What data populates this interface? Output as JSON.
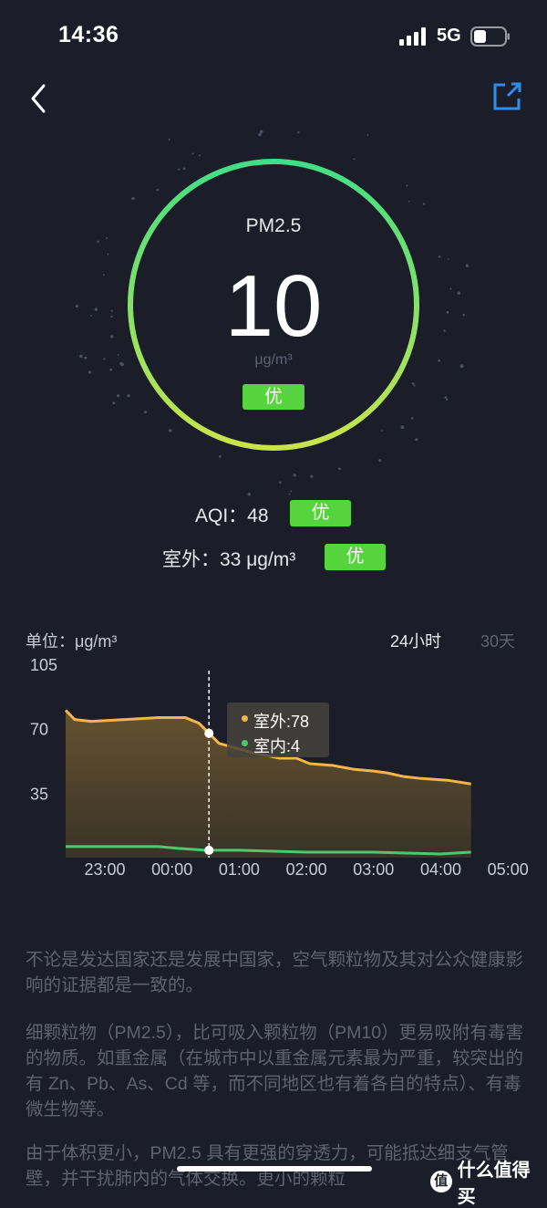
{
  "status_bar": {
    "time": "14:36",
    "network": "5G",
    "icons": [
      "signal-bars-icon",
      "battery-icon"
    ]
  },
  "nav": {
    "icons": [
      "back-chevron-icon",
      "share-icon"
    ],
    "accent": "#2f8cf0"
  },
  "gauge": {
    "pollutant": "PM2.5",
    "value": "10",
    "unit": "μg/m³",
    "level": "优",
    "ring_colors": [
      "#42e08a",
      "#c9e24a"
    ]
  },
  "aqi": {
    "label": "AQI：48",
    "level": "优"
  },
  "outdoor": {
    "label": "室外：33 μg/m³",
    "level": "优"
  },
  "chart_header": {
    "unit_label": "单位：μg/m³",
    "tabs": [
      "24小时",
      "30天"
    ],
    "active_tab": "24小时"
  },
  "chart_data": {
    "type": "area",
    "title": "",
    "xlabel": "",
    "ylabel": "",
    "x_ticks": [
      "23:00",
      "00:00",
      "01:00",
      "02:00",
      "03:00",
      "04:00",
      "05:00"
    ],
    "y_ticks": [
      "105",
      "70",
      "35"
    ],
    "ylim": [
      0,
      105
    ],
    "grid": false,
    "series": [
      {
        "name": "室外",
        "color": "#f4b64b",
        "points": [
          [
            -0.6,
            80
          ],
          [
            -0.45,
            75
          ],
          [
            -0.2,
            74
          ],
          [
            0.3,
            75
          ],
          [
            0.8,
            76
          ],
          [
            1.2,
            76
          ],
          [
            1.4,
            73
          ],
          [
            1.7,
            62
          ],
          [
            2.2,
            57
          ],
          [
            2.6,
            54
          ],
          [
            2.85,
            54
          ],
          [
            3.05,
            51
          ],
          [
            3.4,
            50
          ],
          [
            3.7,
            48
          ],
          [
            4.0,
            47
          ],
          [
            4.2,
            46
          ],
          [
            4.45,
            44
          ],
          [
            4.7,
            43
          ],
          [
            5.1,
            42
          ],
          [
            5.45,
            40
          ]
        ]
      },
      {
        "name": "室内",
        "color": "#4dc86a",
        "points": [
          [
            -0.6,
            6
          ],
          [
            0.8,
            6
          ],
          [
            1.1,
            5
          ],
          [
            1.5,
            4
          ],
          [
            2.0,
            4
          ],
          [
            3.0,
            3
          ],
          [
            4.0,
            3
          ],
          [
            5.0,
            2
          ],
          [
            5.45,
            3
          ]
        ]
      }
    ],
    "cursor_x": 1.55,
    "tooltip": {
      "outdoor": "室外:78",
      "indoor": "室内:4"
    }
  },
  "article": {
    "paragraphs": [
      "不论是发达国家还是发展中国家，空气颗粒物及其对公众健康影响的证据都是一致的。",
      "细颗粒物（PM2.5），比可吸入颗粒物（PM10）更易吸附有毒害的物质。如重金属（在城市中以重金属元素最为严重，较突出的有 Zn、Pb、As、Cd 等，而不同地区也有着各自的特点）、有毒微生物等。",
      "由于体积更小，PM2.5 具有更强的穿透力，可能抵达细支气管壁，并干扰肺内的气体交换。更小的颗粒"
    ]
  },
  "watermark": {
    "text": "值 什么值得买",
    "icon": "watermark-logo-icon"
  }
}
